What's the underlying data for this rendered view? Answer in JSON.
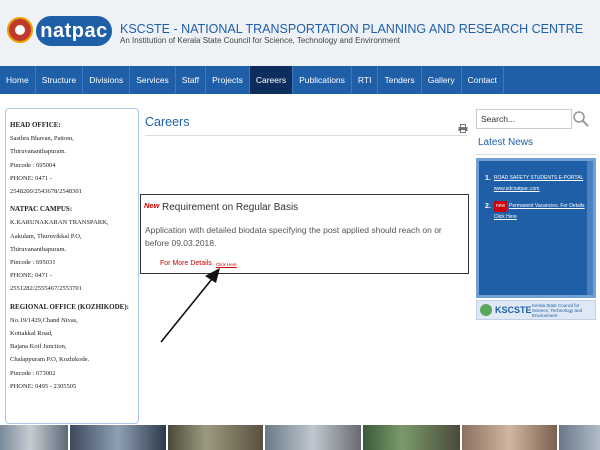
{
  "header": {
    "logo_text": "natpac",
    "title": "KSCSTE - NATIONAL TRANSPORTATION PLANNING AND RESEARCH CENTRE",
    "subtitle": "An Institution of Kerala State Council for Science, Technology and Environment"
  },
  "nav": {
    "items": [
      "Home",
      "Structure",
      "Divisions",
      "Services",
      "Staff",
      "Projects",
      "Careers",
      "Publications",
      "RTI",
      "Tenders",
      "Gallery",
      "Contact"
    ],
    "active": "Careers"
  },
  "contact": {
    "head_office": {
      "heading": "HEAD OFFICE:",
      "lines": [
        "Sasthra Bhavan, Pattom,",
        "Thiruvananthapuram.",
        "Pincode : 695004",
        "PHONE: 0471 -",
        "2548200/2543678/2548301"
      ]
    },
    "campus": {
      "heading": "NATPAC CAMPUS:",
      "lines": [
        "K.KARUNAKARAN TRANSPARK,",
        "Aakulam, Thuruvikkal P.O,",
        "Thiruvananthapuram.",
        "Pincode : 695031",
        "PHONE: 0471 -",
        "2551282/2555467/2553701"
      ]
    },
    "regional": {
      "heading": "REGIONAL OFFICE (KOZHIKODE):",
      "lines": [
        "No.19/1429,Chand Nivas,",
        "Kottakkal Road,",
        "Bajana Koil Junction,",
        "Chalappuram P.O, Kozhikode.",
        "Pincode : 673002",
        "PHONE: 0495 - 2305505"
      ]
    }
  },
  "main": {
    "title": "Careers",
    "notice": {
      "badge": "New",
      "heading": "Requirement on Regular Basis",
      "body": "Application with detailed biodata specifying the post applied should reach on or before 09.03.2018.",
      "more_label": "For More Details",
      "link_text": "Click Here"
    }
  },
  "sidebar": {
    "search_placeholder": "Search...",
    "latest_news_title": "Latest News",
    "news": [
      {
        "num": "1.",
        "text": "ROAD SAFETY STUDENTS E-PORTAL www.sdcnatpac.com"
      },
      {
        "num": "2.",
        "badge": "new",
        "text": "Permanent Vacancies. For Details Click Here"
      }
    ],
    "banner_name": "KSCSTE",
    "banner_desc": "Kerala State Council for Science, Technology and Environment"
  },
  "colors": {
    "brand_blue": "#1f5fa8",
    "nav_active": "#0d2e5c",
    "accent_red": "#cc0000"
  },
  "icons": {
    "search": "search-icon",
    "print": "print-icon",
    "logo": "logo-emblem-icon"
  }
}
